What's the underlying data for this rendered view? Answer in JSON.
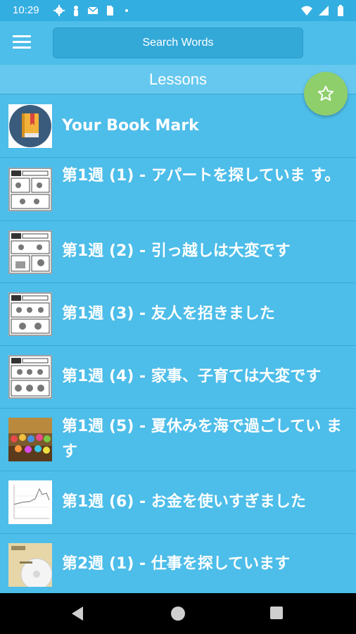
{
  "status_bar": {
    "time": "10:29",
    "left_icons": [
      "gear-icon",
      "person-icon",
      "gmail-icon",
      "sim-icon",
      "dot-icon"
    ],
    "right_icons": [
      "wifi-icon",
      "signal-icon",
      "battery-icon"
    ]
  },
  "app_bar": {
    "menu_icon": "hamburger-icon",
    "search_placeholder": "Search Words"
  },
  "section": {
    "title": "Lessons"
  },
  "fab": {
    "icon": "star-icon",
    "color": "#8fcf6b"
  },
  "lessons": [
    {
      "title": "Your Book Mark",
      "thumb": "bookmark-book"
    },
    {
      "title": "第1週 (1) - アパートを探していま す。",
      "thumb": "manga-apartment"
    },
    {
      "title": "第1週 (2) - 引っ越しは大変です",
      "thumb": "manga-moving"
    },
    {
      "title": "第1週 (3) - 友人を招きました",
      "thumb": "manga-friends"
    },
    {
      "title": "第1週 (4) - 家事、子育ては大変です",
      "thumb": "manga-housework"
    },
    {
      "title": "第1週 (5) - 夏休みを海で過ごしてい ます",
      "thumb": "photo-group"
    },
    {
      "title": "第1週 (6) - お金を使いすぎました",
      "thumb": "line-graph"
    },
    {
      "title": "第2週 (1) - 仕事を探しています",
      "thumb": "book-cd"
    }
  ],
  "colors": {
    "background": "#4dbde9",
    "status_bar": "#33aee0",
    "header": "#66c8ee",
    "text": "#ffffff"
  },
  "nav_bar": {
    "icons": [
      "back-icon",
      "home-icon",
      "recents-icon"
    ]
  }
}
